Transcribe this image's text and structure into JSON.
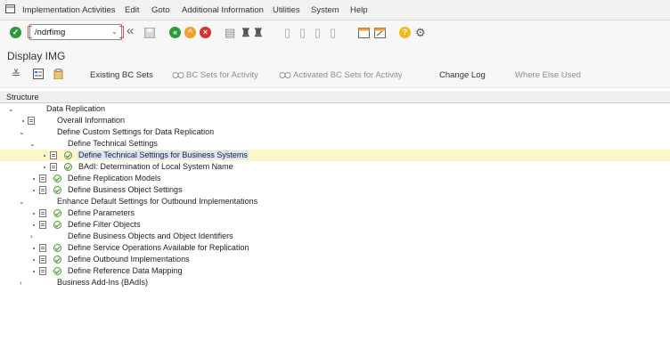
{
  "menubar": {
    "items": [
      "Implementation Activities",
      "Edit",
      "Goto",
      "Additional Information",
      "Utilities",
      "System",
      "Help"
    ]
  },
  "toolbar": {
    "command_value": "/ndrfimg",
    "icons": [
      "enter-icon",
      "back-icon",
      "save-icon",
      "back-nav-icon",
      "exit-icon",
      "cancel-icon",
      "print-icon",
      "find-icon",
      "find-next-icon",
      "first-page-icon",
      "prev-page-icon",
      "next-page-icon",
      "last-page-icon",
      "new-session-icon",
      "shortcut-icon",
      "help-icon",
      "customize-icon"
    ]
  },
  "page": {
    "title": "Display IMG"
  },
  "app_toolbar": {
    "existing_bc_sets": "Existing BC Sets",
    "bc_sets_for_activity": "BC Sets for Activity",
    "activated_bc_sets": "Activated BC Sets for Activity",
    "change_log": "Change Log",
    "where_else_used": "Where Else Used"
  },
  "tree": {
    "header": "Structure",
    "nodes": [
      {
        "label": "Data Replication"
      },
      {
        "label": "Overall Information"
      },
      {
        "label": "Define Custom Settings for Data Replication"
      },
      {
        "label": "Define Technical Settings"
      },
      {
        "label": "Define Technical Settings for Business Systems"
      },
      {
        "label": "BAdI: Determination of Local System Name"
      },
      {
        "label": "Define Replication Models"
      },
      {
        "label": "Define Business Object Settings"
      },
      {
        "label": "Enhance Default Settings for Outbound Implementations"
      },
      {
        "label": "Define Parameters"
      },
      {
        "label": "Define Filter Objects"
      },
      {
        "label": "Define Business Objects and Object Identifiers"
      },
      {
        "label": "Define Service Operations Available for Replication"
      },
      {
        "label": "Define Outbound Implementations"
      },
      {
        "label": "Define Reference Data Mapping"
      },
      {
        "label": "Business Add-Ins (BAdIs)"
      }
    ]
  },
  "colors": {
    "selected_row": "#fdf6c8",
    "enter_green": "#2d9a3a",
    "nav_orange": "#f0a030",
    "nav_red": "#d93030",
    "help_yellow": "#f3b81c"
  }
}
